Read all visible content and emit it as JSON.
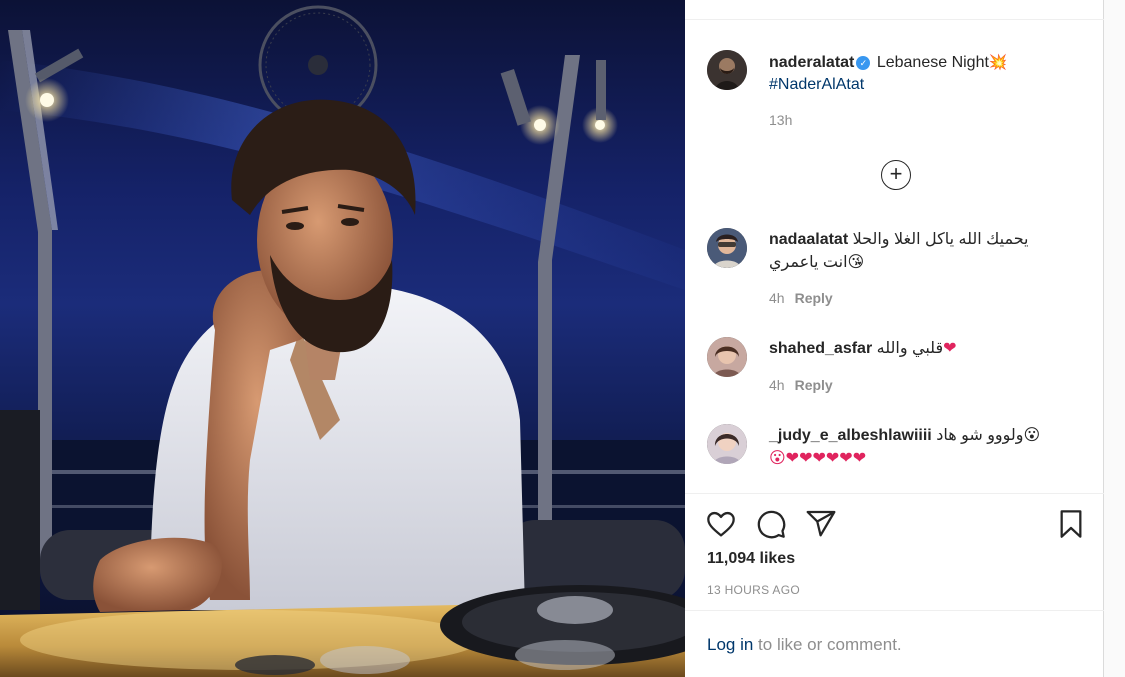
{
  "post": {
    "username": "naderalatat",
    "caption_text": "Lebanese Night",
    "caption_emoji": "💥",
    "hashtag": "#NaderAlAtat",
    "time": "13h",
    "load_more_symbol": "+"
  },
  "comments": [
    {
      "username": "nadaalatat",
      "text": "يحميك الله ياكل الغلا والحلا",
      "text_line2": "انت ياعمري😘",
      "time": "4h",
      "reply_label": "Reply"
    },
    {
      "username": "shahed_asfar",
      "text": "قلبي والله",
      "text_emoji": "❤",
      "time": "4h",
      "reply_label": "Reply"
    },
    {
      "username": "_judy_e_albeshlawiiii",
      "text": "ولووو شو هاد",
      "text_emoji": "😮",
      "text_line2": "😮❤❤❤❤❤❤"
    }
  ],
  "actions": {
    "icons": [
      "heart-icon",
      "comment-icon",
      "share-icon",
      "bookmark-icon"
    ]
  },
  "likes": "11,094 likes",
  "posted_ago": "13 HOURS AGO",
  "login": {
    "link": "Log in",
    "rest": " to like or comment."
  },
  "colors": {
    "text": "#262626",
    "secondary": "#8e8e8e",
    "link": "#00376b",
    "verified": "#3897f0",
    "heart": "#e0245e"
  }
}
